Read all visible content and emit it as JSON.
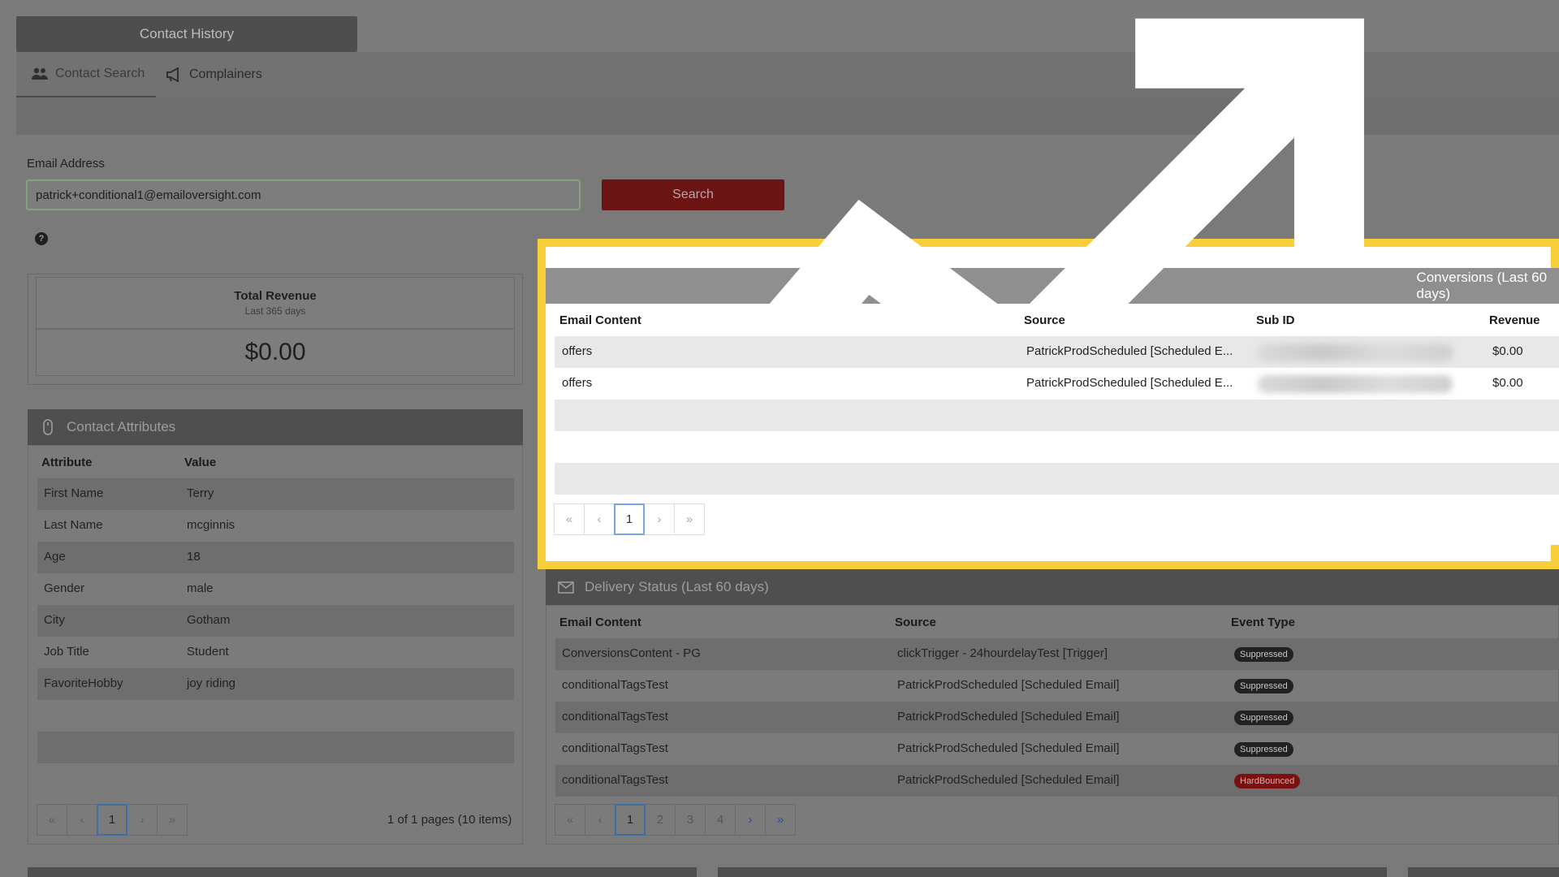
{
  "header": {
    "title": "Contact History",
    "tabs": [
      {
        "label": "Contact Search",
        "icon": "users-icon",
        "active": true
      },
      {
        "label": "Complainers",
        "icon": "megaphone-icon",
        "active": false
      }
    ]
  },
  "search": {
    "label": "Email Address",
    "value": "patrick+conditional1@emailoversight.com",
    "button": "Search"
  },
  "revenue": {
    "title": "Total Revenue",
    "subtitle": "Last 365 days",
    "value": "$0.00"
  },
  "attributes": {
    "title": "Contact Attributes",
    "columns": [
      "Attribute",
      "Value"
    ],
    "rows": [
      {
        "attribute": "First Name",
        "value": "Terry"
      },
      {
        "attribute": "Last Name",
        "value": "mcginnis"
      },
      {
        "attribute": "Age",
        "value": "18"
      },
      {
        "attribute": "Gender",
        "value": "male"
      },
      {
        "attribute": "City",
        "value": "Gotham"
      },
      {
        "attribute": "Job Title",
        "value": "Student"
      },
      {
        "attribute": "FavoriteHobby",
        "value": "joy riding"
      }
    ],
    "pager": {
      "first": "«",
      "prev": "‹",
      "pages": [
        "1"
      ],
      "next": "›",
      "last": "»",
      "info": "1 of 1 pages (10 items)"
    }
  },
  "conversions": {
    "title": "Conversions (Last 60 days)",
    "columns": [
      "Email Content",
      "Source",
      "Sub ID",
      "Revenue"
    ],
    "rows": [
      {
        "content": "offers",
        "source": "PatrickProdScheduled [Scheduled E...",
        "revenue": "$0.00"
      },
      {
        "content": "offers",
        "source": "PatrickProdScheduled [Scheduled E...",
        "revenue": "$0.00"
      }
    ],
    "pager": {
      "first": "«",
      "prev": "‹",
      "pages": [
        "1"
      ],
      "next": "›",
      "last": "»"
    }
  },
  "delivery": {
    "title": "Delivery Status (Last 60 days)",
    "columns": [
      "Email Content",
      "Source",
      "Event Type"
    ],
    "rows": [
      {
        "content": "ConversionsContent - PG",
        "source": "clickTrigger - 24hourdelayTest [Trigger]",
        "event": "Suppressed"
      },
      {
        "content": "conditionalTagsTest",
        "source": "PatrickProdScheduled [Scheduled Email]",
        "event": "Suppressed"
      },
      {
        "content": "conditionalTagsTest",
        "source": "PatrickProdScheduled [Scheduled Email]",
        "event": "Suppressed"
      },
      {
        "content": "conditionalTagsTest",
        "source": "PatrickProdScheduled [Scheduled Email]",
        "event": "Suppressed"
      },
      {
        "content": "conditionalTagsTest",
        "source": "PatrickProdScheduled [Scheduled Email]",
        "event": "HardBounced"
      }
    ],
    "pager": {
      "first": "«",
      "prev": "‹",
      "pages": [
        "1",
        "2",
        "3",
        "4"
      ],
      "next": "›",
      "last": "»"
    }
  },
  "colors": {
    "highlight": "#f7cf3a",
    "search_button": "#6b1414",
    "badge_suppressed": "#222222",
    "badge_hardbounced": "#7a1010"
  }
}
